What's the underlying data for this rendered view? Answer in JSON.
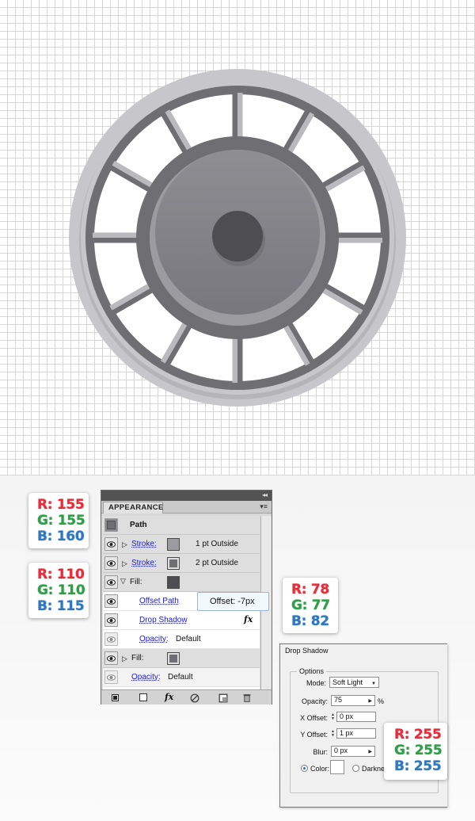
{
  "colors": {
    "canvas_bg": "#ffffff",
    "grid_line": "#d6d6d9",
    "outer_ring": "#c6c6cb",
    "ring_inner_band": "#b4b4b9",
    "spoke_dark": "#6e6e73",
    "spoke_light": "#b9b9be",
    "hub_dark": "#6e6e73",
    "hub_light": "#9b9ba0",
    "hub_face_top": "#8e8e93",
    "hub_face_bottom": "#7a7a80",
    "center_hole": "#4e4d52",
    "fill_swatch_dark": "#4e4d52",
    "stroke_swatch_1": "#9b9ba0",
    "stroke_swatch_2": "#6e6e73"
  },
  "swatches": [
    {
      "r": "R: 155",
      "g": "G: 155",
      "b": "B: 160"
    },
    {
      "r": "R: 110",
      "g": "G: 110",
      "b": "B: 115"
    },
    {
      "r": "R: 78",
      "g": "G: 77",
      "b": "B: 82"
    },
    {
      "r": "R: 255",
      "g": "G: 255",
      "b": "B: 255"
    }
  ],
  "appearance": {
    "tab_label": "APPEARANCE",
    "collapse_glyph": "◂◂",
    "menu_glyph": "▾≡",
    "object_label": "Path",
    "rows": {
      "stroke1": {
        "label": "Stroke:",
        "value": "1 pt  Outside"
      },
      "stroke2": {
        "label": "Stroke:",
        "value": "2 pt  Outside"
      },
      "fill1": {
        "label": "Fill:"
      },
      "offset_path": {
        "label": "Offset Path"
      },
      "drop_shadow": {
        "label": "Drop Shadow",
        "fx": "fx"
      },
      "opacity_inner": {
        "label": "Opacity:",
        "value": "Default"
      },
      "fill2": {
        "label": "Fill:"
      },
      "opacity_outer": {
        "label": "Opacity:",
        "value": "Default"
      }
    },
    "footer_fx": "fx"
  },
  "tooltip": {
    "text": "Offset: -7px"
  },
  "drop_shadow_dialog": {
    "title": "Drop Shadow",
    "group_label": "Options",
    "mode_label": "Mode:",
    "mode_value": "Soft Light",
    "opacity_label": "Opacity:",
    "opacity_value": "75",
    "opacity_unit": "%",
    "x_offset_label": "X Offset:",
    "x_offset_value": "0 px",
    "y_offset_label": "Y Offset:",
    "y_offset_value": "1 px",
    "blur_label": "Blur:",
    "blur_value": "0 px",
    "color_label": "Color:",
    "darkness_label": "Darkness"
  }
}
